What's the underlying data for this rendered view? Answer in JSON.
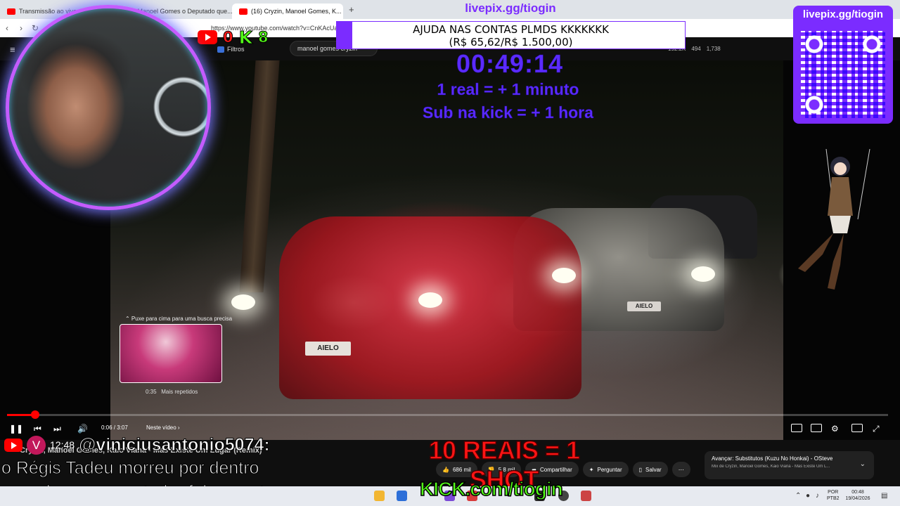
{
  "browser": {
    "tabs": [
      {
        "label": "Transmissão ao vivo - Yo..."
      },
      {
        "label": "(16) Manoel Gomes o Deputado que..."
      },
      {
        "label": "(16) Cryzin, Manoel Gomes, K..."
      }
    ],
    "url": "https://www.youtube.com/watch?v=CnKAcUaovc..."
  },
  "youtube": {
    "filters_label": "Filtros",
    "search_value": "manoel gomes cryzin",
    "stats": [
      "192.2K",
      "494",
      "1,738"
    ]
  },
  "player": {
    "thumb_hint": "⌃ Puxe para cima para uma busca precisa",
    "thumb_time": "0:35",
    "thumb_label": "Mais repetidos",
    "time": "0:06 / 3:07",
    "chapter": "Neste vídeo",
    "progress_fraction": 0.032,
    "hover_fraction": 0.188
  },
  "video_info": {
    "title": "Cryzin, Manoel Gomes, Kaio Viana - Mas Existe Um Lugar (Remix)",
    "likes": "686 mil",
    "dislikes": "5,8 mil",
    "share": "Compartilhar",
    "ask": "Perguntar",
    "save": "Salvar",
    "next_title": "Avançar: Substitutos (Kuzu No Honkai) - OSteve",
    "next_sub": "Mix de Cryzin, Manoel Gomes, Kaio Viana - Mas Existe Um L..."
  },
  "stream": {
    "livepix_top": "livepix.gg/tiogin",
    "qr_label": "livepix.gg/tiogin",
    "youtube_count": "0",
    "kick_logo": "K",
    "kick_count": "8",
    "goal_title": "AJUDA NAS CONTAS PLMDS KKKKKKK",
    "goal_amount": "(R$ 65,62/R$ 1.500,00)",
    "goal_fraction": 0.044,
    "timer": "00:49:14",
    "rule1": "1 real = + 1 minuto",
    "rule2": "Sub na kick = + 1 hora",
    "shot": "10 REAIS = 1 SHOT",
    "kick_url": "KICK.com/tiogin",
    "accent": "#7b2cff",
    "kick_green": "#53fc18"
  },
  "chat": {
    "avatar_letter": "V",
    "time": "12:48",
    "user": "@viniciusantonio5074:",
    "line1": "o Régis Tadeu morreu por dentro",
    "line2": "quando o apresentador falou cantor"
  },
  "video_scene": {
    "plate_front": "AIELO",
    "plate_back": "AIELO"
  },
  "taskbar": {
    "lang1": "POR",
    "lang2": "PTB2",
    "time": "00:48",
    "date": "19/04/2026"
  }
}
